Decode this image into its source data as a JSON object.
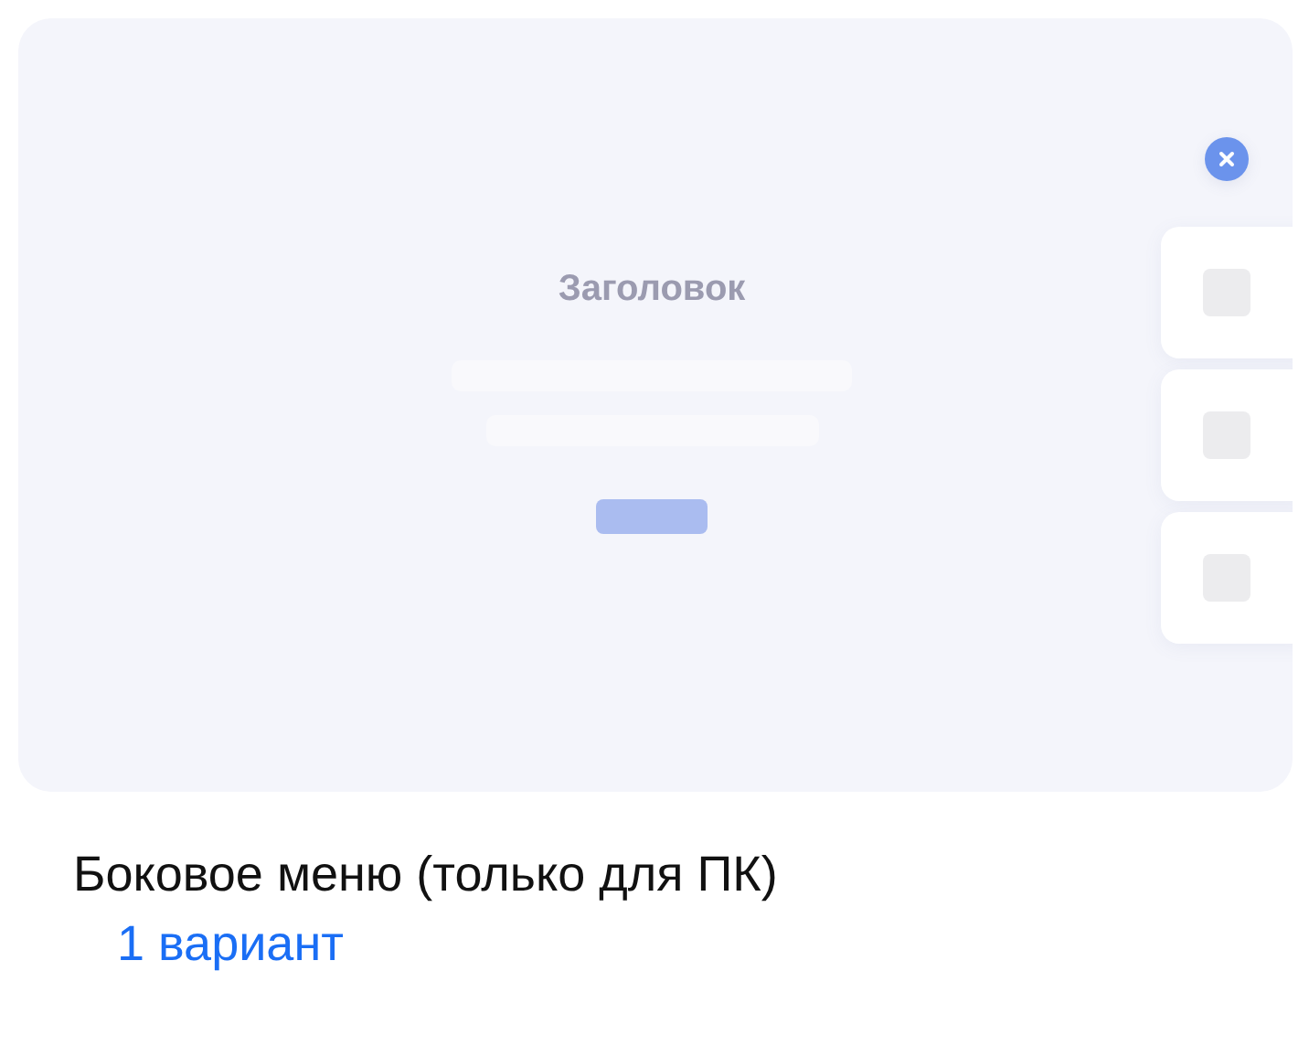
{
  "preview": {
    "title": "Заголовок",
    "button": {
      "kind": "primary"
    },
    "close_button": {
      "kind": "close"
    },
    "side_menu": [
      {
        "kind": "icon"
      },
      {
        "kind": "icon"
      },
      {
        "kind": "icon"
      }
    ]
  },
  "caption": {
    "title": "Боковое меню (только для ПК)",
    "variants": "1 вариант"
  }
}
